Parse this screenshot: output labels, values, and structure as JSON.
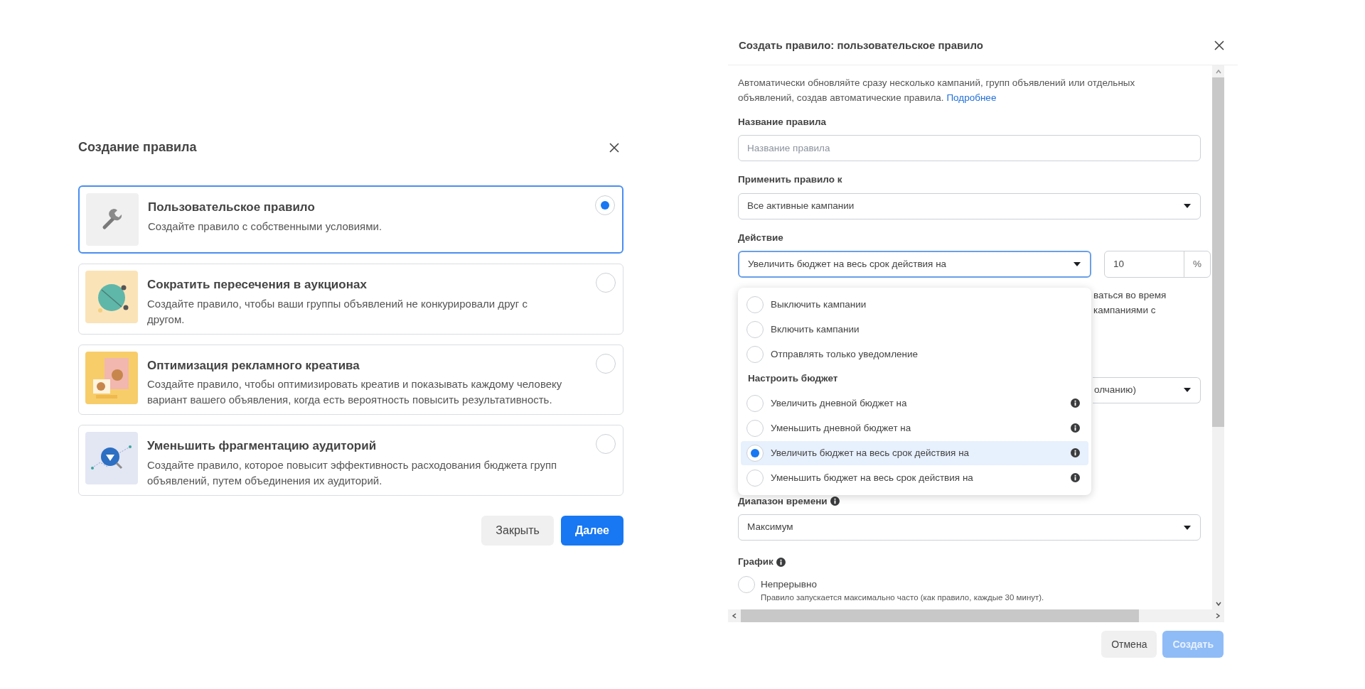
{
  "rule_picker": {
    "title": "Создание правила",
    "options": [
      {
        "kind": "wrench",
        "title": "Пользовательское правило",
        "description": "Создайте правило с собственными условиями.",
        "selected": true
      },
      {
        "kind": "globe",
        "title": "Сократить пересечения в аукционах",
        "description": "Создайте правило, чтобы ваши группы объявлений не конкурировали друг с другом.",
        "selected": false
      },
      {
        "kind": "creative",
        "title": "Оптимизация рекламного креатива",
        "description": "Создайте правило, чтобы оптимизировать креатив и показывать каждому человеку вариант вашего объявления, когда есть вероятность повысить результативность.",
        "selected": false
      },
      {
        "kind": "audience",
        "title": "Уменьшить фрагментацию аудиторий",
        "description": "Создайте правило, которое повысит эффективность расходования бюджета групп объявлений, путем объединения их аудиторий.",
        "selected": false
      }
    ],
    "buttons": [
      {
        "label": "Закрыть",
        "kind": "secondary"
      },
      {
        "label": "Далее",
        "kind": "primary"
      }
    ]
  },
  "custom_rule_dialog": {
    "title": "Создать правило: пользовательское правило",
    "intro": {
      "text": "Автоматически обновляйте сразу несколько кампаний, групп объявлений или отдельных объявлений, создав автоматические правила.",
      "link": "Подробнее"
    },
    "rule_name": {
      "label": "Название правила",
      "placeholder": "Название правила"
    },
    "apply_to": {
      "label": "Применить правило к",
      "value": "Все активные кампании"
    },
    "action": {
      "label": "Действие",
      "value": "Увеличить бюджет на весь срок действия на",
      "amount": "10",
      "unit": "%",
      "expanded": true,
      "menu": [
        {
          "kind": "option",
          "label": "Выключить кампании",
          "selected": false,
          "info": false
        },
        {
          "kind": "option",
          "label": "Включить кампании",
          "selected": false,
          "info": false
        },
        {
          "kind": "option",
          "label": "Отправлять только уведомление",
          "selected": false,
          "info": false
        },
        {
          "kind": "heading",
          "label": "Настроить бюджет"
        },
        {
          "kind": "option",
          "label": "Увеличить дневной бюджет на",
          "selected": false,
          "info": true
        },
        {
          "kind": "option",
          "label": "Уменьшить дневной бюджет на",
          "selected": false,
          "info": true
        },
        {
          "kind": "option",
          "label": "Увеличить бюджет на весь срок действия на",
          "selected": true,
          "info": true
        },
        {
          "kind": "option",
          "label": "Уменьшить бюджет на весь срок действия на",
          "selected": false,
          "info": true
        }
      ]
    },
    "covered_note": [
      "ваться во время",
      "кампаниями с"
    ],
    "covered_select": {
      "value": "олчанию)"
    },
    "time_range": {
      "label": "Диапазон времени",
      "info": true,
      "value": "Максимум"
    },
    "schedule": {
      "label": "График",
      "info": true,
      "options": [
        {
          "label": "Непрерывно",
          "description": "Правило запускается максимально часто (как правило, каждые 30 минут).",
          "selected": false
        }
      ]
    },
    "buttons": [
      {
        "label": "Отмена",
        "kind": "secondary",
        "disabled": false
      },
      {
        "label": "Создать",
        "kind": "primary",
        "disabled": true
      }
    ]
  }
}
